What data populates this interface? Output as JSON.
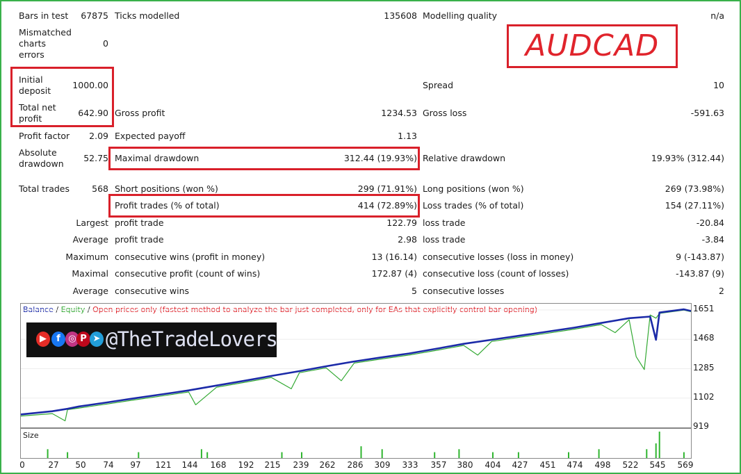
{
  "report": {
    "bars_label": "Bars in test",
    "bars_value": "67875",
    "ticks_label": "Ticks modelled",
    "ticks_value": "135608",
    "modelling_label": "Modelling quality",
    "modelling_value": "n/a",
    "mismatched_l1": "Mismatched",
    "mismatched_l2": "charts",
    "mismatched_l3": "errors",
    "mismatched_value": "0",
    "initial_l1": "Initial",
    "initial_l2": "deposit",
    "initial_value": "1000.00",
    "spread_label": "Spread",
    "spread_value": "10",
    "netprofit_l1": "Total net",
    "netprofit_l2": "profit",
    "netprofit_value": "642.90",
    "grossprofit_label": "Gross profit",
    "grossprofit_value": "1234.53",
    "grossloss_label": "Gross loss",
    "grossloss_value": "-591.63",
    "pf_label": "Profit factor",
    "pf_value": "2.09",
    "payoff_label": "Expected payoff",
    "payoff_value": "1.13",
    "absdd_l1": "Absolute",
    "absdd_l2": "drawdown",
    "absdd_value": "52.75",
    "maxdd_label": "Maximal drawdown",
    "maxdd_value": "312.44 (19.93%)",
    "reldd_label": "Relative drawdown",
    "reldd_value": "19.93% (312.44)",
    "trades_label": "Total trades",
    "trades_value": "568",
    "short_label": "Short positions (won %)",
    "short_value": "299 (71.91%)",
    "long_label": "Long positions (won %)",
    "long_value": "269 (73.98%)",
    "profittrades_label": "Profit trades (% of total)",
    "profittrades_value": "414 (72.89%)",
    "losstrades_label": "Loss trades (% of total)",
    "losstrades_value": "154 (27.11%)",
    "largest_label": "Largest",
    "largest_profit_label": "profit trade",
    "largest_profit_value": "122.79",
    "largest_loss_label": "loss trade",
    "largest_loss_value": "-20.84",
    "average_label": "Average",
    "average_profit_label": "profit trade",
    "average_profit_value": "2.98",
    "average_loss_label": "loss trade",
    "average_loss_value": "-3.84",
    "maximum_label": "Maximum",
    "max_wins_label": "consecutive wins (profit in money)",
    "max_wins_value": "13 (16.14)",
    "max_losses_label": "consecutive losses (loss in money)",
    "max_losses_value": "9 (-143.87)",
    "maximal_label": "Maximal",
    "maximal_profit_label": "consecutive profit (count of wins)",
    "maximal_profit_value": "172.87 (4)",
    "maximal_loss_label": "consecutive loss (count of losses)",
    "maximal_loss_value": "-143.87 (9)",
    "average2_label": "Average",
    "avg_wins_label": "consecutive wins",
    "avg_wins_value": "5",
    "avg_losses_label": "consecutive losses",
    "avg_losses_value": "2"
  },
  "symbol_badge": "AUDCAD",
  "chart": {
    "legend_balance": "Balance",
    "legend_sep1": " / ",
    "legend_equity": "Equity",
    "legend_sep2": " / ",
    "legend_note": "Open prices only (fastest method to analyze the bar just completed, only for EAs that explicitly control bar opening)",
    "size_label": "Size",
    "brand_handle": "@TheTradeLovers",
    "colors": {
      "balance": "#1b2aa8",
      "equity": "#33a933",
      "highlight": "#d9202a",
      "frame": "#39b14a"
    }
  },
  "chart_data": {
    "type": "line",
    "title": "",
    "xlabel": "",
    "ylabel": "",
    "yticks": [
      "1651",
      "1468",
      "1285",
      "1102",
      "919"
    ],
    "xticks": [
      "0",
      "27",
      "50",
      "74",
      "97",
      "121",
      "144",
      "168",
      "192",
      "215",
      "239",
      "262",
      "286",
      "309",
      "333",
      "357",
      "380",
      "404",
      "427",
      "451",
      "474",
      "498",
      "522",
      "545",
      "569"
    ],
    "xlim": [
      0,
      575
    ],
    "ylim": [
      919,
      1690
    ],
    "series": [
      {
        "name": "Balance",
        "x": [
          0,
          27,
          40,
          50,
          74,
          97,
          121,
          144,
          168,
          192,
          215,
          239,
          262,
          286,
          309,
          333,
          357,
          380,
          404,
          427,
          451,
          474,
          498,
          522,
          540,
          545,
          548,
          569,
          575
        ],
        "y": [
          1000,
          1020,
          1035,
          1050,
          1075,
          1100,
          1125,
          1150,
          1180,
          1210,
          1240,
          1270,
          1300,
          1330,
          1355,
          1380,
          1410,
          1440,
          1465,
          1490,
          1515,
          1540,
          1570,
          1600,
          1610,
          1465,
          1635,
          1655,
          1645
        ]
      },
      {
        "name": "Equity",
        "x": [
          0,
          27,
          38,
          40,
          50,
          74,
          97,
          121,
          144,
          150,
          168,
          192,
          215,
          232,
          239,
          262,
          275,
          286,
          309,
          333,
          357,
          380,
          392,
          404,
          427,
          451,
          474,
          498,
          510,
          522,
          528,
          535,
          540,
          545,
          548,
          569,
          575
        ],
        "y": [
          990,
          1005,
          960,
          1030,
          1040,
          1065,
          1090,
          1115,
          1140,
          1060,
          1170,
          1200,
          1230,
          1160,
          1260,
          1290,
          1210,
          1320,
          1345,
          1370,
          1400,
          1430,
          1370,
          1455,
          1480,
          1505,
          1530,
          1560,
          1510,
          1590,
          1360,
          1280,
          1620,
          1600,
          1630,
          1650,
          1640
        ]
      }
    ],
    "size_bars": {
      "x": [
        23,
        40,
        101,
        155,
        160,
        224,
        241,
        292,
        310,
        355,
        376,
        405,
        427,
        470,
        496,
        537,
        545,
        548,
        569
      ],
      "values": [
        3,
        2,
        2,
        3,
        2,
        2,
        2,
        4,
        3,
        2,
        3,
        2,
        2,
        2,
        3,
        3,
        5,
        9,
        2
      ]
    }
  }
}
